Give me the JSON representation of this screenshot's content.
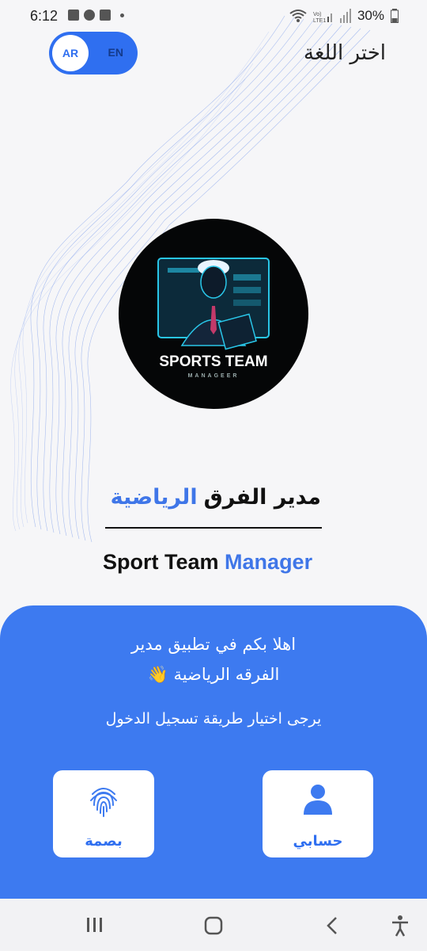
{
  "status_bar": {
    "time": "6:12",
    "battery": "30%"
  },
  "language": {
    "label": "اختر اللغة",
    "options": [
      "AR",
      "EN"
    ],
    "selected": "AR"
  },
  "logo": {
    "line1": "SPORTS TEAM",
    "line2": "MANAGEER"
  },
  "title_ar": {
    "part1": "مدير الفرق",
    "part2": "الرياضية"
  },
  "title_en": {
    "part1": "Sport Team",
    "part2": "Manager"
  },
  "panel": {
    "welcome_line1": "اهلا بكم في تطبيق مدير",
    "welcome_line2": "الفرقه الرياضية 👋",
    "prompt": "يرجى اختيار طريقة تسجيل الدخول",
    "fingerprint_label": "بصمة",
    "account_label": "حسابي"
  },
  "colors": {
    "accent": "#3d7af0",
    "text": "#111111",
    "background": "#f6f6f8"
  },
  "icons": [
    "fingerprint-icon",
    "person-icon",
    "recents-icon",
    "home-icon",
    "back-icon",
    "accessibility-icon"
  ]
}
